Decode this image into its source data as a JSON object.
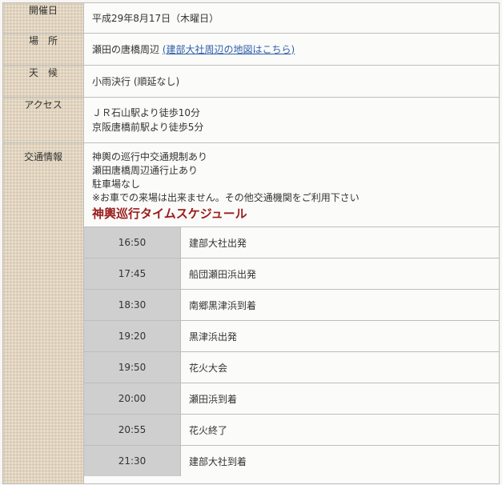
{
  "rows": {
    "date": {
      "label": "開催日",
      "value": "平成29年8月17日（木曜日）"
    },
    "place": {
      "label": "場　所",
      "value": "瀬田の唐橋周辺",
      "link": "(建部大社周辺の地図はこちら)"
    },
    "weather": {
      "label": "天　候",
      "value": "小雨決行 (順延なし)"
    },
    "access": {
      "label": "アクセス",
      "lines": [
        "ＪＲ石山駅より徒歩10分",
        "京阪唐橋前駅より徒歩5分"
      ]
    },
    "traffic": {
      "label": "交通情報",
      "lines": [
        "神輿の巡行中交通規制あり",
        "瀬田唐橋周辺通行止あり",
        "駐車場なし",
        "※お車での来場は出来ません。その他交通機関をご利用下さい"
      ]
    }
  },
  "schedule": {
    "title": "神輿巡行タイムスケジュール",
    "items": [
      {
        "time": "16:50",
        "event": "建部大社出発"
      },
      {
        "time": "17:45",
        "event": "船団瀬田浜出発"
      },
      {
        "time": "18:30",
        "event": "南郷黒津浜到着"
      },
      {
        "time": "19:20",
        "event": "黒津浜出発"
      },
      {
        "time": "19:50",
        "event": "花火大会"
      },
      {
        "time": "20:00",
        "event": "瀬田浜到着"
      },
      {
        "time": "20:55",
        "event": "花火終了"
      },
      {
        "time": "21:30",
        "event": "建部大社到着"
      }
    ]
  }
}
